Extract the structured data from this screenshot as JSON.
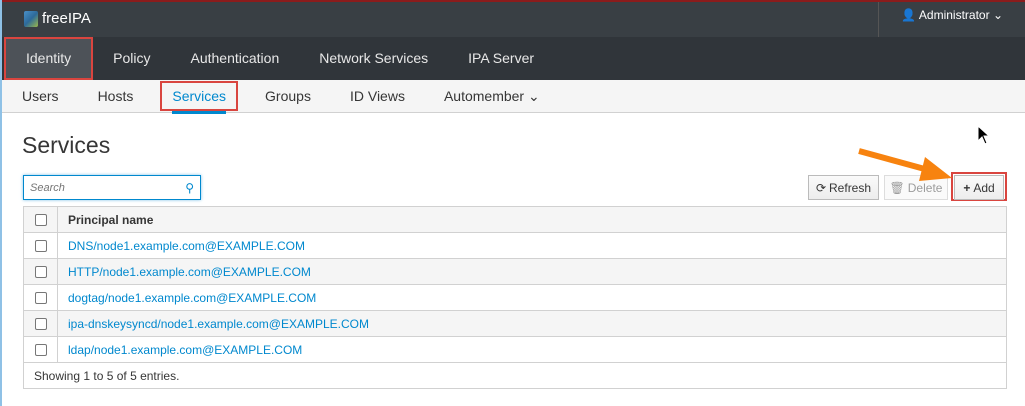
{
  "app": {
    "name": "freeIPA",
    "user": "Administrator"
  },
  "nav": [
    "Identity",
    "Policy",
    "Authentication",
    "Network Services",
    "IPA Server"
  ],
  "subnav": [
    "Users",
    "Hosts",
    "Services",
    "Groups",
    "ID Views",
    "Automember"
  ],
  "page": {
    "title": "Services",
    "search_placeholder": "Search"
  },
  "buttons": {
    "refresh": "Refresh",
    "delete": "Delete",
    "add": "Add"
  },
  "table": {
    "header": "Principal name",
    "rows": [
      "DNS/node1.example.com@EXAMPLE.COM",
      "HTTP/node1.example.com@EXAMPLE.COM",
      "dogtag/node1.example.com@EXAMPLE.COM",
      "ipa-dnskeysyncd/node1.example.com@EXAMPLE.COM",
      "ldap/node1.example.com@EXAMPLE.COM"
    ],
    "footer": "Showing 1 to 5 of 5 entries."
  },
  "colors": {
    "accent": "#0088ce",
    "highlight": "#d9453f",
    "arrow": "#f7830f"
  }
}
